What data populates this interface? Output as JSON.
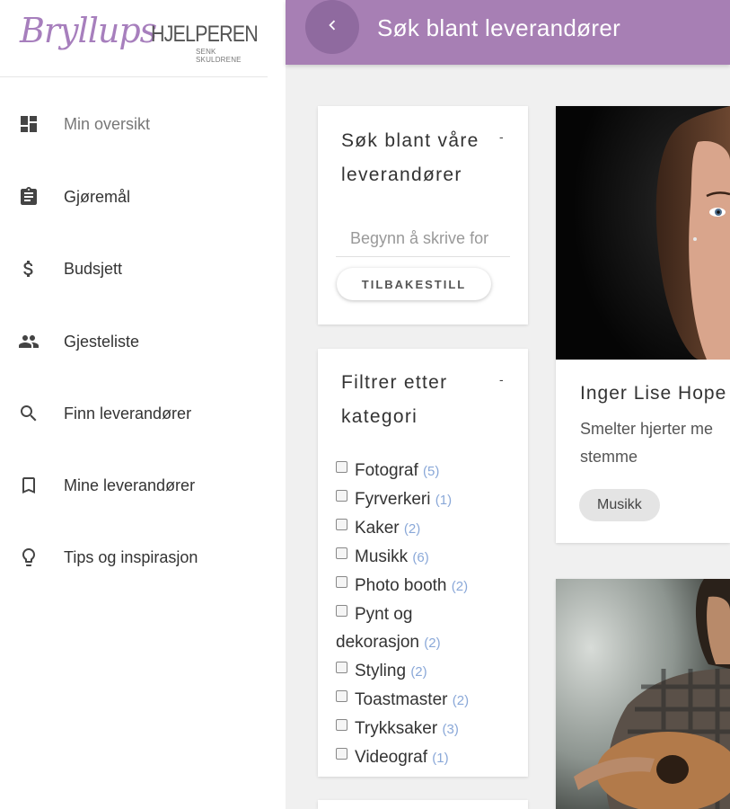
{
  "sidebar": {
    "logo": {
      "script": "Bryllups",
      "caps": "HJELPEREN",
      "tagline": "SENK SKULDRENE"
    },
    "items": [
      {
        "label": "Min oversikt",
        "icon": "dashboard-icon"
      },
      {
        "label": "Gjøremål",
        "icon": "clipboard-icon"
      },
      {
        "label": "Budsjett",
        "icon": "dollar-icon"
      },
      {
        "label": "Gjesteliste",
        "icon": "people-icon"
      },
      {
        "label": "Finn leverandører",
        "icon": "search-icon"
      },
      {
        "label": "Mine leverandører",
        "icon": "bookmark-icon"
      },
      {
        "label": "Tips og inspirasjon",
        "icon": "lightbulb-icon"
      }
    ]
  },
  "header": {
    "back_icon": "chevron-left-icon",
    "title": "Søk blant leverandører"
  },
  "search_card": {
    "title_line1": "Søk blant våre",
    "title_line2": "leverandører",
    "collapse": "-",
    "placeholder": "Begynn å skrive for",
    "reset_label": "TILBAKESTILL"
  },
  "filter_card": {
    "title_line1": "Filtrer etter",
    "title_line2": "kategori",
    "collapse": "-",
    "categories": [
      {
        "name": "Fotograf",
        "count": "(5)"
      },
      {
        "name": "Fyrverkeri",
        "count": "(1)"
      },
      {
        "name": "Kaker",
        "count": "(2)"
      },
      {
        "name": "Musikk",
        "count": "(6)"
      },
      {
        "name": "Photo booth",
        "count": "(2)"
      },
      {
        "name": "Pynt og dekorasjon",
        "count": "(2)"
      },
      {
        "name": "Styling",
        "count": "(2)"
      },
      {
        "name": "Toastmaster",
        "count": "(2)"
      },
      {
        "name": "Trykksaker",
        "count": "(3)"
      },
      {
        "name": "Videograf",
        "count": "(1)"
      }
    ]
  },
  "vendors": [
    {
      "name": "Inger Lise Hope",
      "description": "Smelter hjerter me stemme",
      "tag": "Musikk"
    }
  ],
  "colors": {
    "brand": "#a77fb4",
    "brand_dark": "#8f6a9f",
    "count": "#8aa8d8"
  }
}
